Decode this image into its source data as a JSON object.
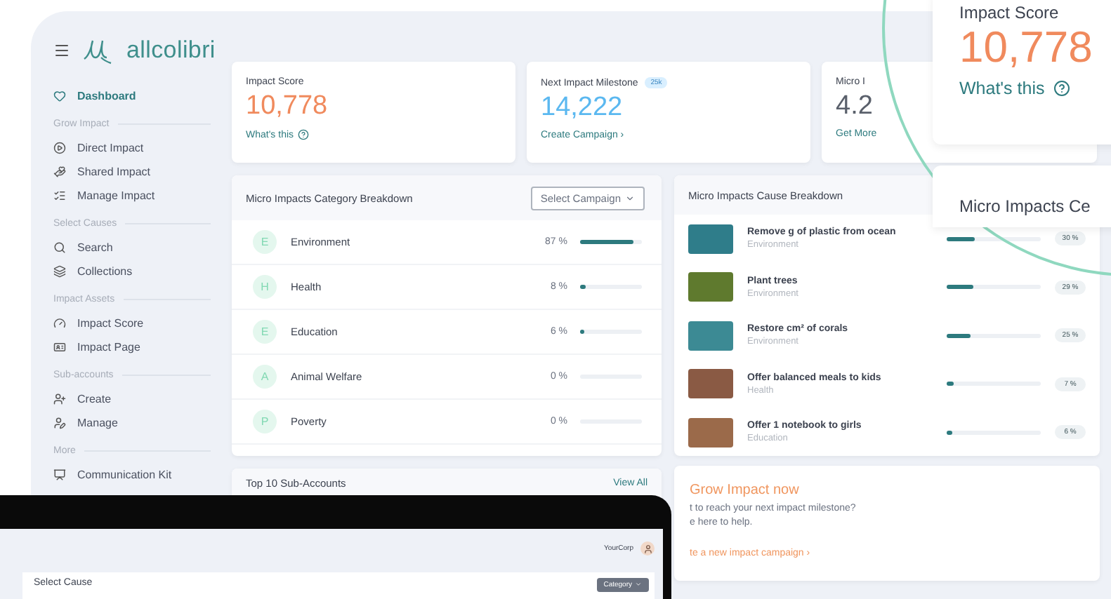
{
  "brand": {
    "name": "allcolibri"
  },
  "sidebar": {
    "sections": [
      {
        "items": [
          {
            "label": "Dashboard",
            "selected": true
          }
        ]
      },
      {
        "heading": "Grow Impact",
        "items": [
          {
            "label": "Direct Impact",
            "selected": false
          },
          {
            "label": "Shared Impact",
            "selected": false
          },
          {
            "label": "Manage Impact",
            "selected": false
          }
        ]
      },
      {
        "heading": "Select Causes",
        "items": [
          {
            "label": "Search",
            "selected": false
          },
          {
            "label": "Collections",
            "selected": false
          }
        ]
      },
      {
        "heading": "Impact Assets",
        "items": [
          {
            "label": "Impact Score",
            "selected": false
          },
          {
            "label": "Impact Page",
            "selected": false
          }
        ]
      },
      {
        "heading": "Sub-accounts",
        "items": [
          {
            "label": "Create",
            "selected": false
          },
          {
            "label": "Manage",
            "selected": false
          }
        ]
      },
      {
        "heading": "More",
        "items": [
          {
            "label": "Communication Kit",
            "selected": false
          }
        ]
      }
    ]
  },
  "stat_cards": [
    {
      "kind": "score",
      "label": "Impact Score",
      "value": "10,778",
      "link": "What's this"
    },
    {
      "kind": "milestone",
      "label": "Next Impact Milestone",
      "badge": "25k",
      "value": "14,222",
      "link": "Create Campaign ›"
    },
    {
      "kind": "assets",
      "label": "Micro I",
      "value": "4.2",
      "link": "Get More"
    }
  ],
  "category_breakdown": {
    "title": "Micro Impacts Category Breakdown",
    "select": "Select Campaign",
    "rows": [
      {
        "letter": "E",
        "name": "Environment",
        "reading": "87 %",
        "level": 0.87
      },
      {
        "letter": "H",
        "name": "Health",
        "reading": "8 %",
        "level": 0.08
      },
      {
        "letter": "E",
        "name": "Education",
        "reading": "6 %",
        "level": 0.06
      },
      {
        "letter": "A",
        "name": "Animal Welfare",
        "reading": "0 %",
        "level": 0
      },
      {
        "letter": "P",
        "name": "Poverty",
        "reading": "0 %",
        "level": 0
      }
    ]
  },
  "cause_breakdown": {
    "title": "Micro Impacts Cause Breakdown",
    "rows": [
      {
        "title": "Remove g of plastic from ocean",
        "category": "Environment",
        "level": 0.3,
        "reading": "30 %"
      },
      {
        "title": "Plant trees",
        "category": "Environment",
        "level": 0.29,
        "reading": "29 %"
      },
      {
        "title": "Restore cm² of corals",
        "category": "Environment",
        "level": 0.25,
        "reading": "25 %"
      },
      {
        "title": "Offer balanced meals to kids",
        "category": "Health",
        "level": 0.07,
        "reading": "7 %"
      },
      {
        "title": "Offer 1 notebook to girls",
        "category": "Education",
        "level": 0.06,
        "reading": "6 %"
      }
    ]
  },
  "sub_accounts": {
    "title": "Top 10 Sub-Accounts",
    "link": "View All"
  },
  "grow_card": {
    "title": "Grow Impact now",
    "lines": [
      "t to reach your next impact milestone?",
      "e here to help."
    ],
    "link": "te a new impact campaign ›"
  },
  "magnifier": {
    "label": "Impact Score",
    "value": "10,778",
    "link": "What's this",
    "next_title": "Micro Impacts Ce"
  },
  "laptop": {
    "user": "YourCorp",
    "panel_title": "Select Cause",
    "button": "Category"
  }
}
